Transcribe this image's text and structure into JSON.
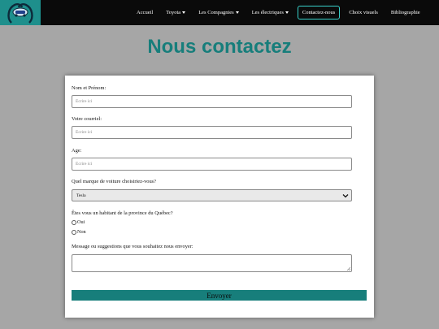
{
  "nav": {
    "logo": "logo-icon",
    "items": [
      {
        "label": "Accueil",
        "dropdown": false,
        "active": false
      },
      {
        "label": "Toyota",
        "dropdown": true,
        "active": false
      },
      {
        "label": "Les Compagnies",
        "dropdown": true,
        "active": false
      },
      {
        "label": "Les électriques",
        "dropdown": true,
        "active": false
      },
      {
        "label": "Contactez-nous",
        "dropdown": false,
        "active": true
      },
      {
        "label": "Choix visuels",
        "dropdown": false,
        "active": false
      },
      {
        "label": "Bibliographie",
        "dropdown": false,
        "active": false
      }
    ]
  },
  "page": {
    "title": "Nous contactez"
  },
  "form": {
    "name_label": "Nom et Prénom:",
    "name_placeholder": "Écrire ici",
    "email_label": "Votre courriel:",
    "email_placeholder": "Écrire ici",
    "age_label": "Age:",
    "age_placeholder": "Écrire ici",
    "brand_label": "Quel marque de voiture choisiriez-vous?",
    "brand_selected": "Tesla",
    "resident_label": "Êtes vous un habitant de la province du Québec?",
    "radio_yes": "Oui",
    "radio_no": "Non",
    "message_label": "Message ou suggestions que vous souhaitez nous envoyer:",
    "submit_label": "Envoyer"
  },
  "colors": {
    "accent": "#177e7b",
    "nav_bg": "#0a0a0a",
    "page_bg": "#a6a6a6",
    "active_border": "#38d1cb"
  }
}
